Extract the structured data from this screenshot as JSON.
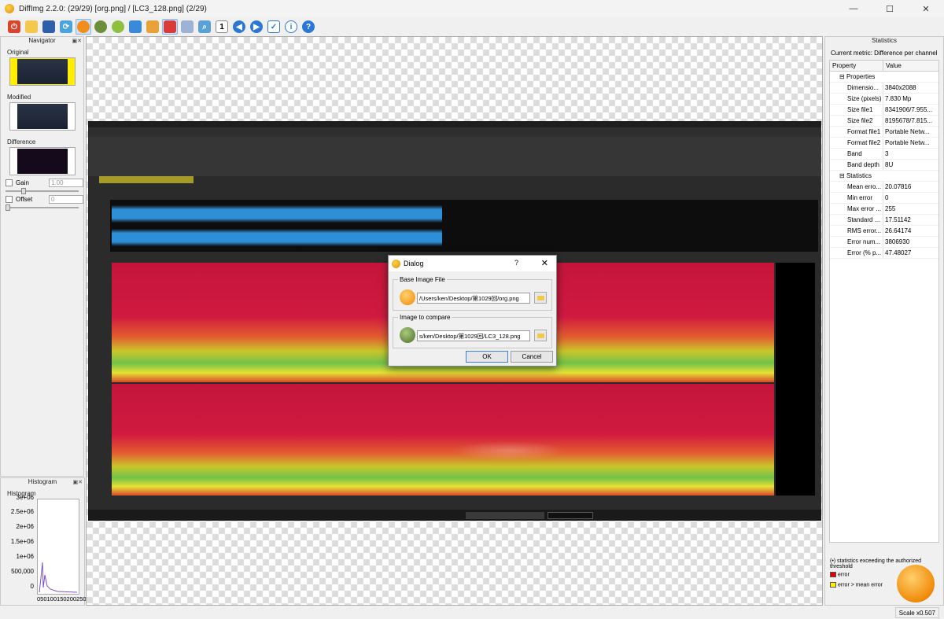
{
  "window": {
    "title": "DiffImg 2.2.0:  (29/29) [org.png] / [LC3_128.png] (2/29)",
    "minimize": "—",
    "maximize": "☐",
    "close": "✕"
  },
  "toolbar": [
    "power",
    "open",
    "save",
    "refresh",
    "base-image",
    "compare-image",
    "green-ball",
    "dual-panel",
    "image-panel",
    "red-overlay",
    "swap",
    "zoom",
    "one-to-one",
    "back",
    "forward",
    "checklist",
    "info",
    "help"
  ],
  "navigator": {
    "title": "Navigator",
    "original": "Original",
    "modified": "Modified",
    "difference": "Difference",
    "gain_label": "Gain",
    "gain_value": "1.00",
    "offset_label": "Offset",
    "offset_value": "0"
  },
  "histogram": {
    "title": "Histogram",
    "label": "Histogram",
    "yticks": [
      "3e+06",
      "2.5e+06",
      "2e+06",
      "1.5e+06",
      "1e+06",
      "500,000",
      "0"
    ],
    "xticks": "050100150200250"
  },
  "dialog": {
    "title": "Dialog",
    "help": "?",
    "close": "✕",
    "base_label": "Base Image File",
    "base_path": "/Users/ken/Desktop/第1029回/org.png",
    "compare_label": "Image to compare",
    "compare_path": "s/ken/Desktop/第1029回/LC3_128.png",
    "ok": "OK",
    "cancel": "Cancel"
  },
  "stats": {
    "title": "Statistics",
    "metric": "Current metric: Difference per channel",
    "col_property": "Property",
    "col_value": "Value",
    "group_properties": "Properties",
    "group_statistics": "Statistics",
    "properties": [
      {
        "p": "Dimensio...",
        "v": "3840x2088"
      },
      {
        "p": "Size (pixels)",
        "v": "7.830 Mp"
      },
      {
        "p": "Size file1",
        "v": "8341906/7.955..."
      },
      {
        "p": "Size file2",
        "v": "8195678/7.815..."
      },
      {
        "p": "Format file1",
        "v": "Portable Netw..."
      },
      {
        "p": "Format file2",
        "v": "Portable Netw..."
      },
      {
        "p": "Band",
        "v": "3"
      },
      {
        "p": "Band depth",
        "v": "8U"
      }
    ],
    "statistics": [
      {
        "p": "Mean erro...",
        "v": "20.07816"
      },
      {
        "p": "Min error",
        "v": "0"
      },
      {
        "p": "Max error ...",
        "v": "255"
      },
      {
        "p": "Standard ...",
        "v": "17.51142"
      },
      {
        "p": "RMS error...",
        "v": "26.64174"
      },
      {
        "p": "Error num...",
        "v": "3806930"
      },
      {
        "p": "Error (% p...",
        "v": "47.48027"
      }
    ],
    "legend_note": "(•) statistics exceeding the authorized threshold",
    "legend_error": "error",
    "legend_mean": "error > mean error"
  },
  "status": {
    "scale": "Scale x0.507"
  },
  "colors": {
    "accent": "#3c7fd4",
    "error": "#e00000",
    "mean": "#ffee00"
  }
}
